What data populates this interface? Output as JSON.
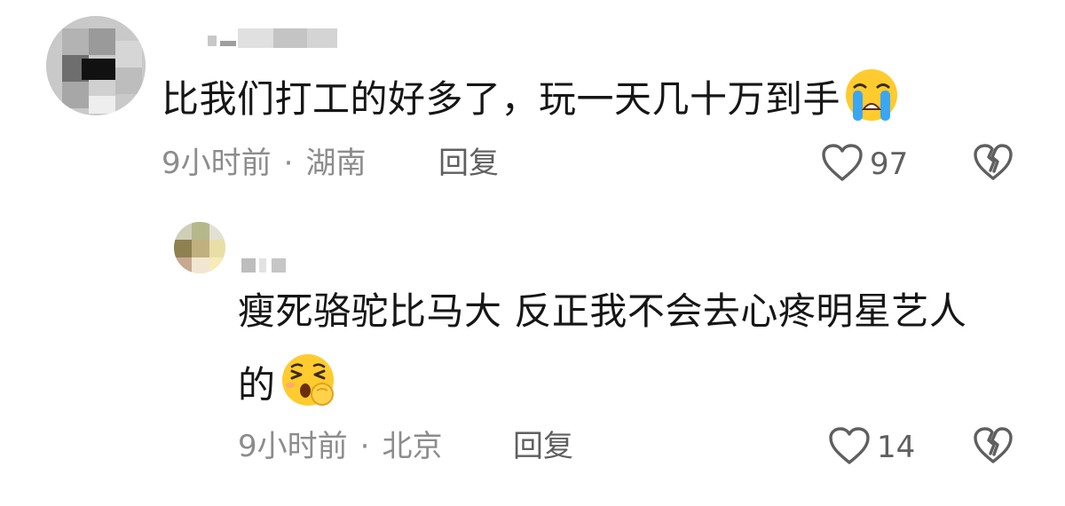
{
  "comments": [
    {
      "text": "比我们打工的好多了，玩一天几十万到手",
      "emoji_icon": "loudly-crying-face-icon",
      "time": "9小时前",
      "separator": "·",
      "location": "湖南",
      "reply_label": "回复",
      "like_count": "97"
    },
    {
      "text_line1": "瘦死骆驼比马大 反正我不会去心疼明星艺人",
      "text_line2": "的",
      "emoji_icon": "shushing-face-icon",
      "time": "9小时前",
      "separator": "·",
      "location": "北京",
      "reply_label": "回复",
      "like_count": "14"
    }
  ],
  "colors": {
    "text": "#161616",
    "meta": "#8c8c8c",
    "action": "#5f5f5f"
  }
}
